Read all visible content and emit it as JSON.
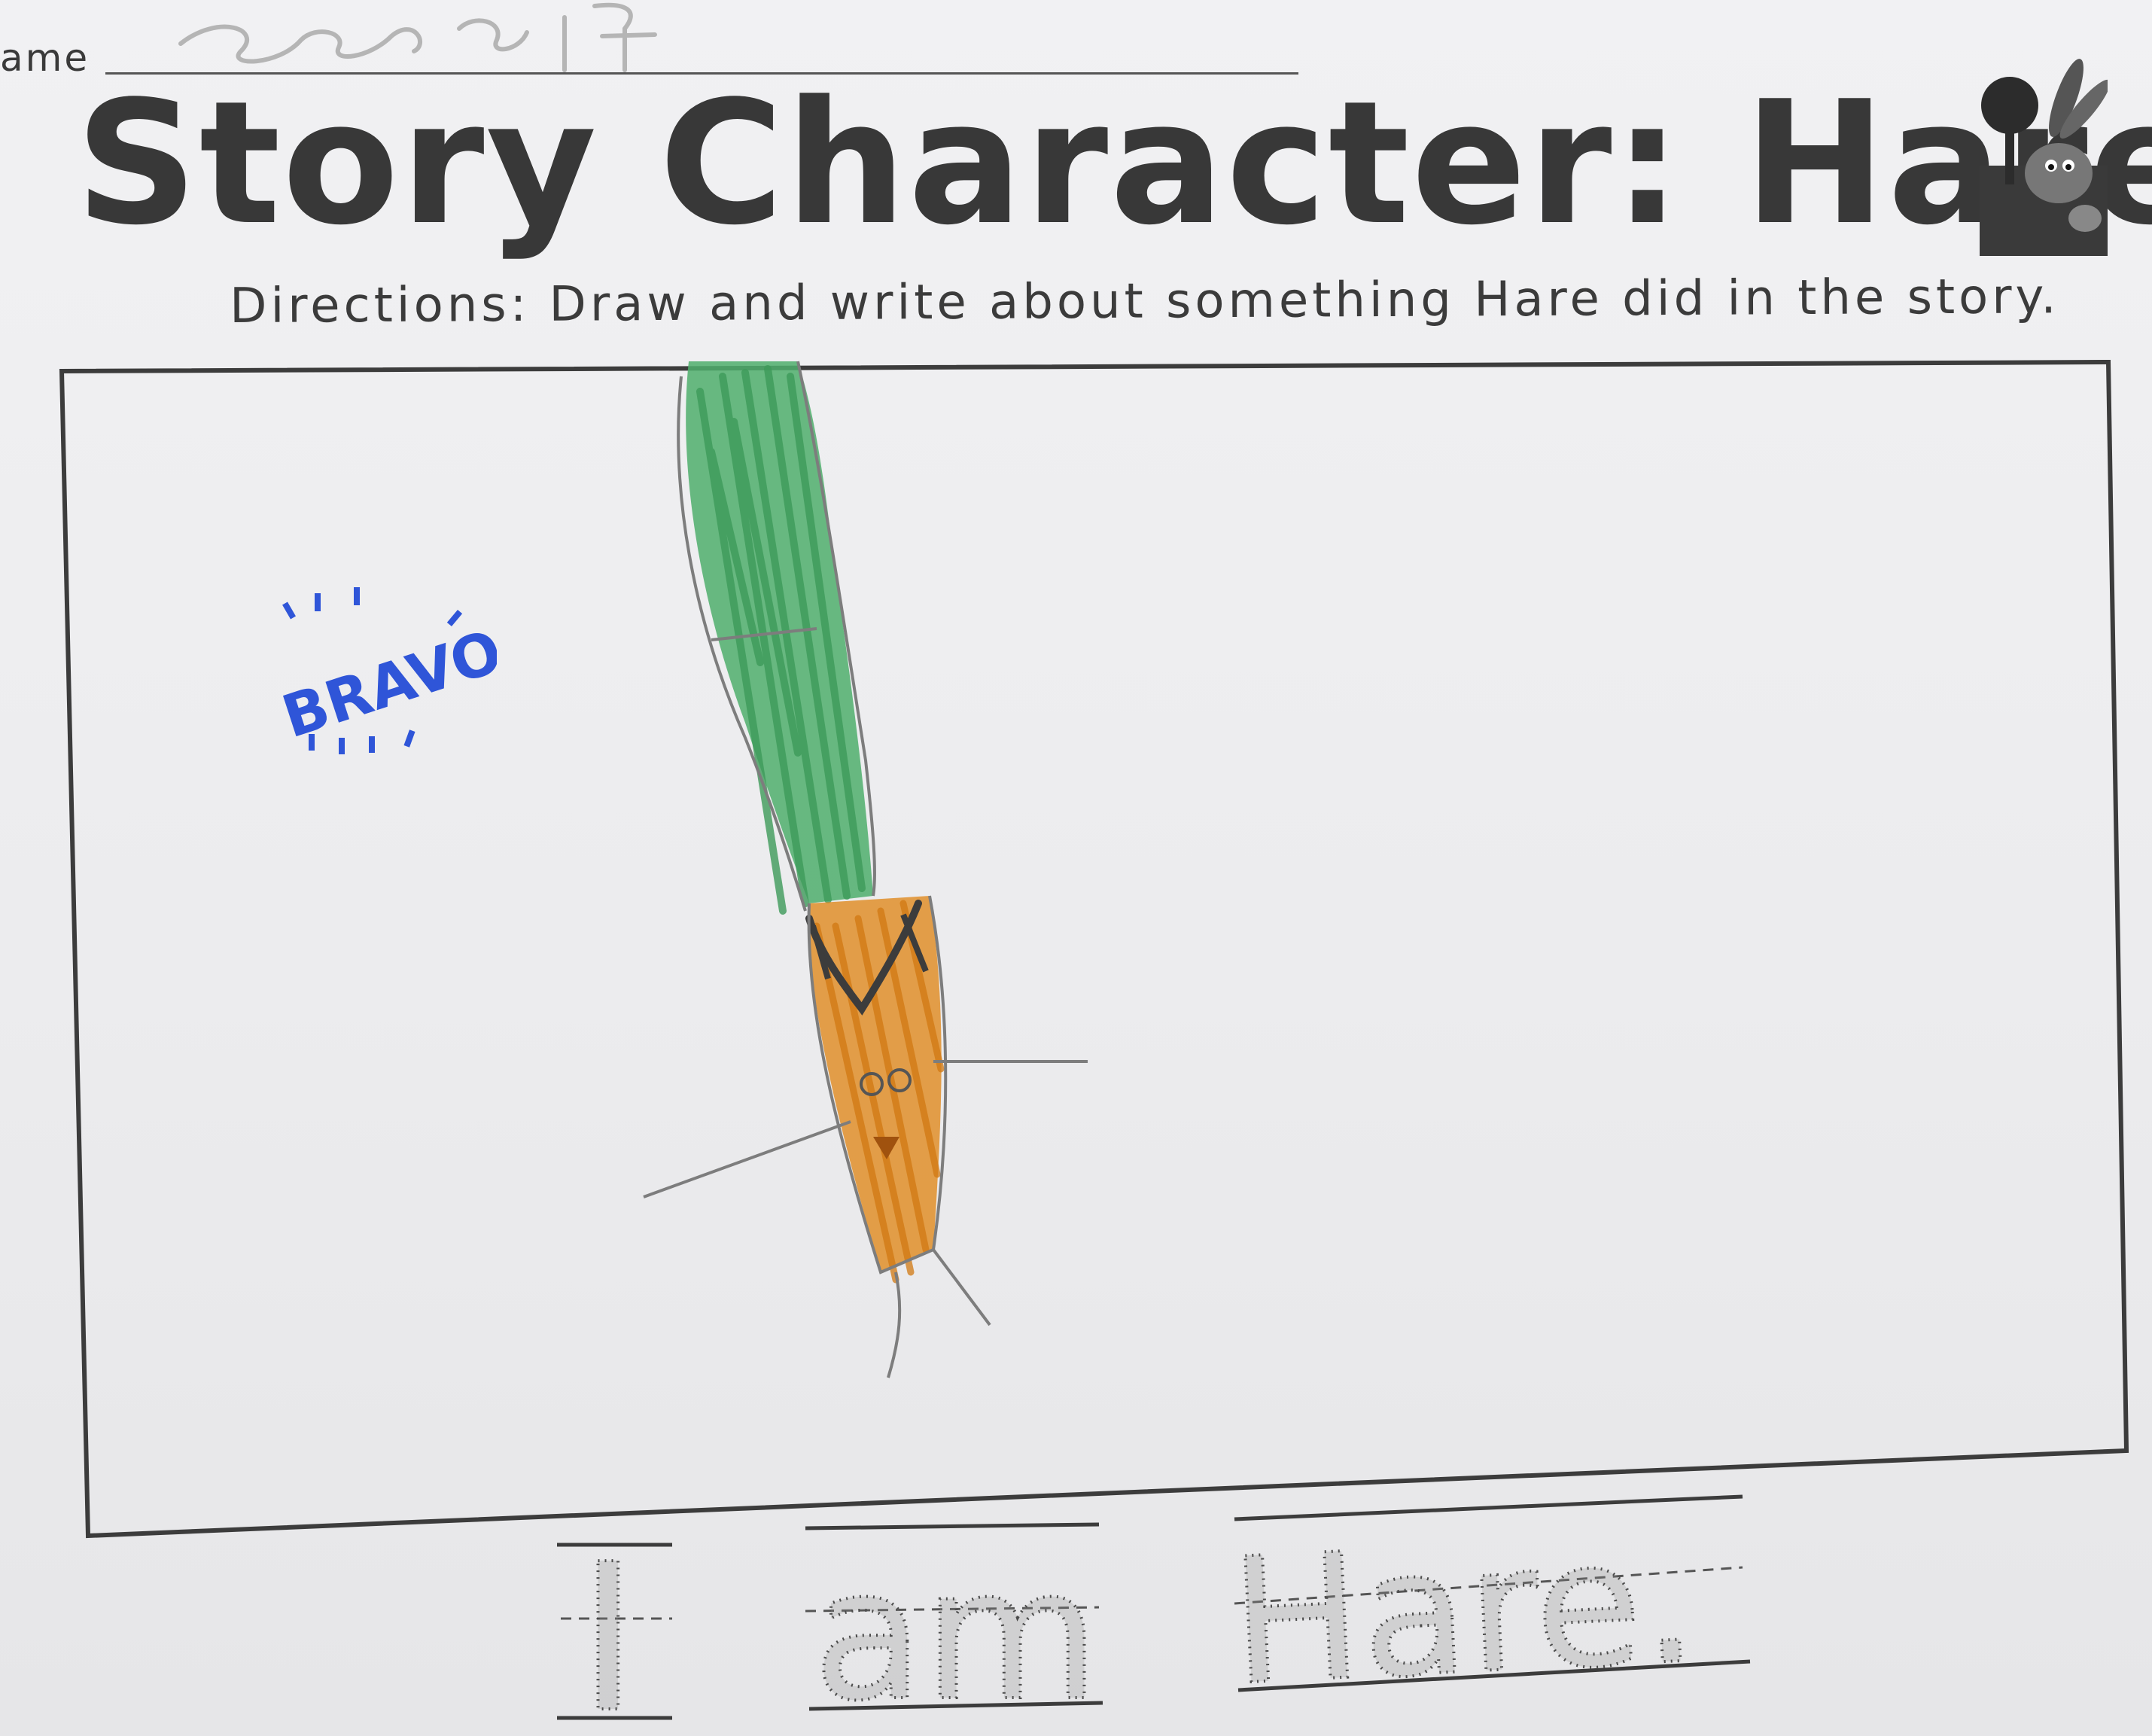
{
  "worksheet": {
    "name_label": "ame",
    "title": "Story Character: Hare",
    "directions": "Directions: Draw and write about something Hare did in the story.",
    "stamp_text": "BRAVO!",
    "sentence_words": [
      "I",
      "am",
      "Hare."
    ]
  },
  "colors": {
    "crayon_green": "#4fae6c",
    "crayon_orange": "#e08a1e",
    "stamp_blue": "#2f55d8",
    "pencil": "#7d7d7d",
    "frame": "#3c3c3c"
  }
}
